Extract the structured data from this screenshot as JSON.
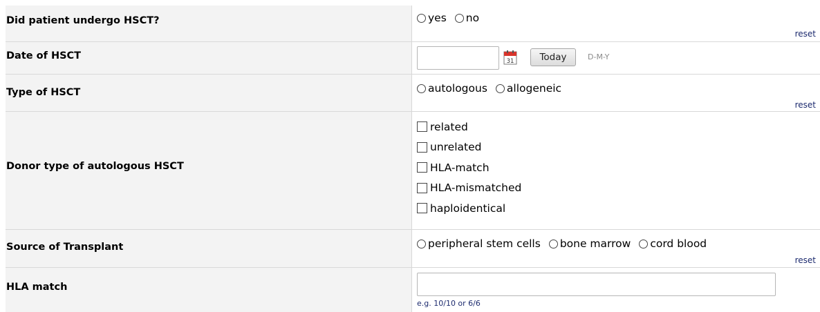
{
  "rows": {
    "hsct": {
      "label": "Did patient undergo HSCT?",
      "options": [
        "yes",
        "no"
      ],
      "reset": "reset"
    },
    "date": {
      "label": "Date of HSCT",
      "value": "",
      "today_button": "Today",
      "format_hint": "D-M-Y",
      "calendar_day": "31"
    },
    "type": {
      "label": "Type of HSCT",
      "options": [
        "autologous",
        "allogeneic"
      ],
      "reset": "reset"
    },
    "donor": {
      "label": "Donor type of autologous HSCT",
      "options": [
        "related",
        "unrelated",
        "HLA-match",
        "HLA-mismatched",
        "haploidentical"
      ]
    },
    "source": {
      "label": "Source of Transplant",
      "options": [
        "peripheral stem cells",
        "bone marrow",
        "cord blood"
      ],
      "reset": "reset"
    },
    "hla": {
      "label": "HLA match",
      "value": "",
      "hint": "e.g. 10/10 or 6/6"
    }
  },
  "colors": {
    "label_bg": "#f3f3f3",
    "border": "#d8d8d8",
    "link": "#1c2a6e",
    "calendar_red": "#d9342b"
  },
  "icons": {
    "calendar": "calendar-icon"
  }
}
